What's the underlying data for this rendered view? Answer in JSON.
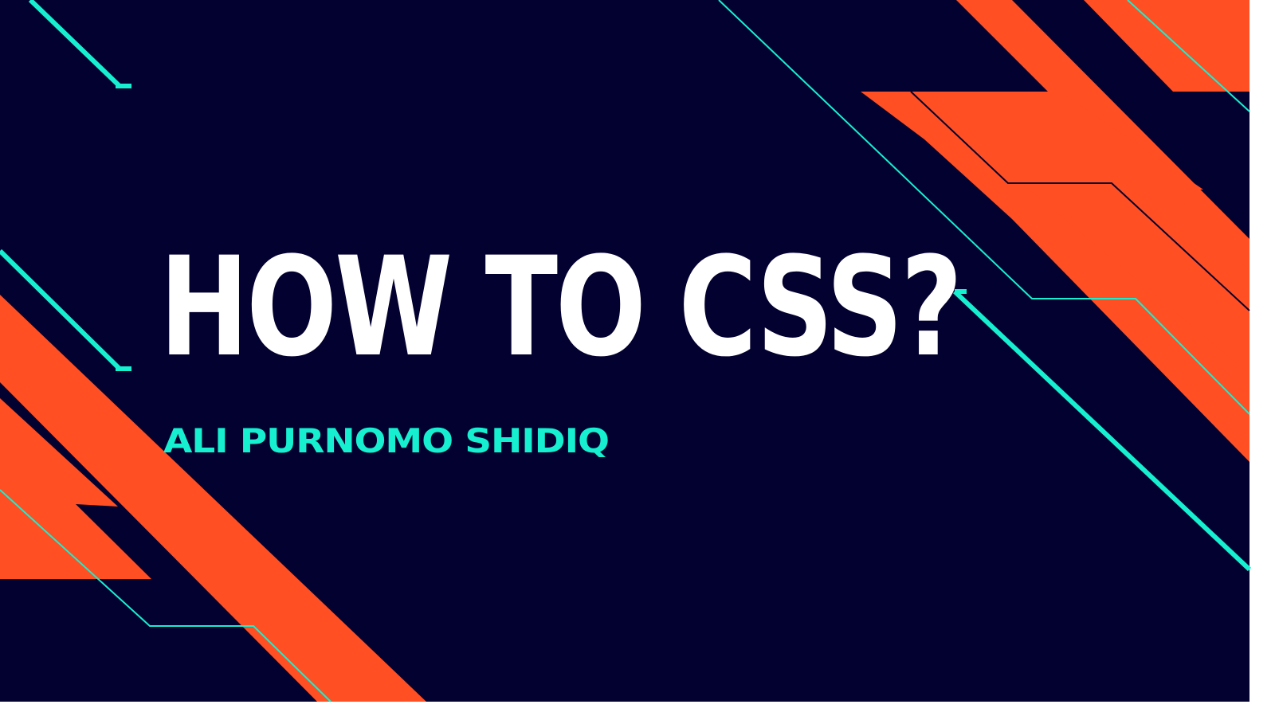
{
  "slide": {
    "title": "HOW TO CSS?",
    "author": "ALI PURNOMO SHIDIQ"
  },
  "colors": {
    "background": "#03012f",
    "accent_orange": "#ff4f23",
    "accent_cyan": "#16f0d1",
    "title_text": "#ffffff",
    "white_frame": "#ffffff"
  }
}
